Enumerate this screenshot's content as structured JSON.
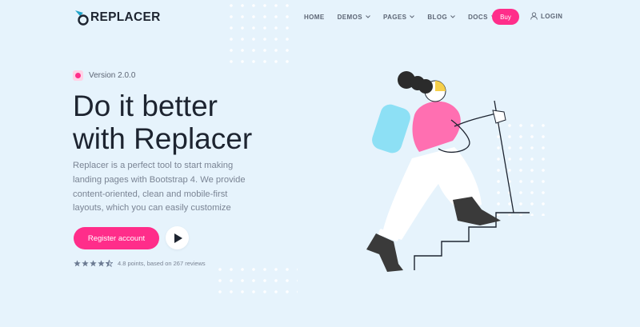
{
  "brand": {
    "name": "REPLACER",
    "accent": "#ff2d8a",
    "logo_color": "#1fa2c9"
  },
  "nav": {
    "items": [
      {
        "label": "HOME",
        "dropdown": false
      },
      {
        "label": "DEMOS",
        "dropdown": true
      },
      {
        "label": "PAGES",
        "dropdown": true
      },
      {
        "label": "BLOG",
        "dropdown": true
      },
      {
        "label": "DOCS",
        "dropdown": true
      }
    ],
    "buy_label": "Buy",
    "login_label": "LOGIN"
  },
  "hero": {
    "version": "Version 2.0.0",
    "headline": [
      "Do it better",
      "with Replacer"
    ],
    "description": [
      "Replacer is a perfect tool to start making",
      "landing pages with Bootstrap 4. We provide",
      "content-oriented, clean and mobile-first",
      "layouts, which you can easily customize"
    ],
    "register_label": "Register account",
    "rating": {
      "stars": 4.5,
      "text": "4.8 points, based on 267 reviews"
    }
  }
}
